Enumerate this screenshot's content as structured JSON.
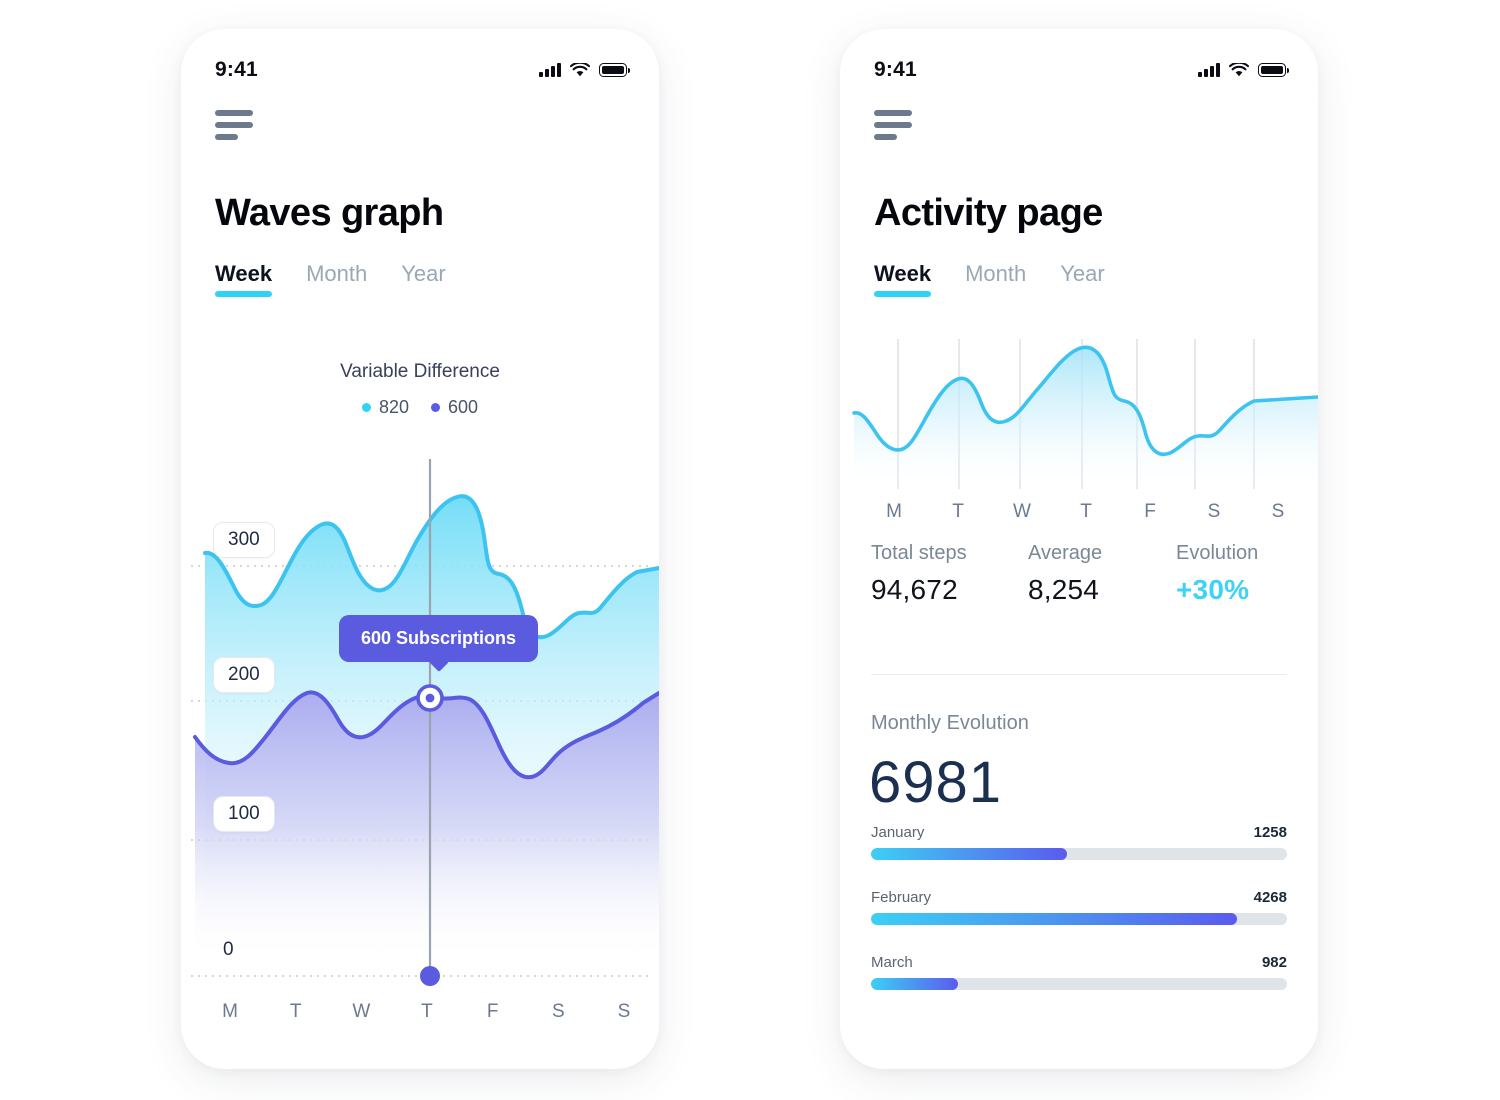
{
  "meta": {
    "accent_cyan": "#2fd3f5",
    "accent_purple": "#5b5be0",
    "text_dark": "#0c1220",
    "text_muted": "#7b8795"
  },
  "phone_left": {
    "status": {
      "time": "9:41",
      "cellular_icon": "cellular-icon",
      "wifi_icon": "wifi-icon",
      "battery_icon": "battery-icon"
    },
    "menu_icon": "hamburger-menu-icon",
    "title": "Waves graph",
    "tabs": [
      {
        "label": "Week",
        "active": true
      },
      {
        "label": "Month",
        "active": false
      },
      {
        "label": "Year",
        "active": false
      }
    ],
    "chart_title": "Variable Difference",
    "legend": [
      {
        "label": "820",
        "color": "#2fd3f5"
      },
      {
        "label": "600",
        "color": "#5b5bea"
      }
    ],
    "y_labels": [
      "300",
      "200",
      "100",
      "0"
    ],
    "x_labels": [
      "M",
      "T",
      "W",
      "T",
      "F",
      "S",
      "S"
    ],
    "tooltip": "600 Subscriptions"
  },
  "phone_right": {
    "status": {
      "time": "9:41",
      "cellular_icon": "cellular-icon",
      "wifi_icon": "wifi-icon",
      "battery_icon": "battery-icon"
    },
    "menu_icon": "hamburger-menu-icon",
    "title": "Activity page",
    "tabs": [
      {
        "label": "Week",
        "active": true
      },
      {
        "label": "Month",
        "active": false
      },
      {
        "label": "Year",
        "active": false
      }
    ],
    "x_labels": [
      "M",
      "T",
      "W",
      "T",
      "F",
      "S",
      "S"
    ],
    "stats": [
      {
        "label": "Total steps",
        "value": "94,672",
        "accent": false
      },
      {
        "label": "Average",
        "value": "8,254",
        "accent": false
      },
      {
        "label": "Evolution",
        "value": "+30%",
        "accent": true
      }
    ],
    "monthly": {
      "label": "Monthly Evolution",
      "total": "6981",
      "rows": [
        {
          "name": "January",
          "value": "1258",
          "pct": 47
        },
        {
          "name": "February",
          "value": "4268",
          "pct": 88
        },
        {
          "name": "March",
          "value": "982",
          "pct": 21
        }
      ]
    }
  },
  "chart_data": [
    {
      "type": "area",
      "title": "Variable Difference",
      "id": "waves-graph",
      "xlabel": "",
      "ylabel": "",
      "categories": [
        "M",
        "T",
        "W",
        "T",
        "F",
        "S",
        "S"
      ],
      "yticks": [
        0,
        100,
        200,
        300
      ],
      "ylim": [
        0,
        360
      ],
      "grid": true,
      "legend_position": "top-center",
      "annotation": {
        "text": "600 Subscriptions",
        "at_category": "T",
        "series": "600"
      },
      "series": [
        {
          "name": "820",
          "color": "#2fd3f5",
          "values": [
            305,
            268,
            330,
            312,
            350,
            268,
            300
          ],
          "x_dense": [
            0,
            0.25,
            0.5,
            0.75,
            1.0,
            1.3,
            1.6,
            1.9,
            2.2,
            2.5,
            2.8,
            3.0,
            3.3,
            3.6,
            3.9,
            4.1,
            4.3,
            4.6,
            4.9,
            5.2,
            5.5,
            5.8,
            6.0
          ],
          "y_dense": [
            308,
            306,
            288,
            272,
            270,
            282,
            312,
            330,
            327,
            308,
            300,
            308,
            330,
            348,
            350,
            333,
            312,
            310,
            272,
            268,
            286,
            300,
            318
          ]
        },
        {
          "name": "600",
          "color": "#5b5bea",
          "values": [
            178,
            165,
            200,
            200,
            207,
            160,
            200
          ],
          "x_dense": [
            0,
            0.3,
            0.6,
            0.9,
            1.2,
            1.5,
            1.8,
            2.1,
            2.4,
            2.7,
            3.0,
            3.3,
            3.6,
            3.9,
            4.2,
            4.5,
            4.8,
            5.1,
            5.4,
            5.7,
            6.0
          ],
          "y_dense": [
            180,
            168,
            165,
            172,
            186,
            200,
            198,
            182,
            176,
            186,
            200,
            204,
            206,
            196,
            170,
            160,
            163,
            178,
            186,
            192,
            205
          ]
        }
      ]
    },
    {
      "type": "area",
      "id": "activity-week",
      "title": "",
      "categories": [
        "M",
        "T",
        "W",
        "T",
        "F",
        "S",
        "S"
      ],
      "grid": true,
      "legend_position": "none",
      "series": [
        {
          "name": "Steps",
          "color": "#3dc3ef",
          "values": [
            8200,
            5400,
            10100,
            9100,
            13900,
            5200,
            9800
          ],
          "x_dense": [
            0,
            0.3,
            0.6,
            0.9,
            1.2,
            1.5,
            1.8,
            2.1,
            2.4,
            2.7,
            3.0,
            3.3,
            3.6,
            3.9,
            4.2,
            4.5,
            4.8,
            5.1,
            5.4,
            5.7,
            6.0
          ],
          "y_dense": [
            9100,
            9200,
            7100,
            5400,
            5300,
            7200,
            9900,
            10100,
            8900,
            8400,
            8500,
            10400,
            12600,
            13800,
            13900,
            11100,
            10900,
            6200,
            5300,
            7000,
            9800
          ]
        }
      ]
    },
    {
      "type": "bar",
      "id": "monthly-evolution",
      "title": "Monthly Evolution",
      "orientation": "horizontal",
      "total": 6981,
      "categories": [
        "January",
        "February",
        "March"
      ],
      "values": [
        1258,
        4268,
        982
      ],
      "bar_percent": [
        47,
        88,
        21
      ]
    }
  ]
}
